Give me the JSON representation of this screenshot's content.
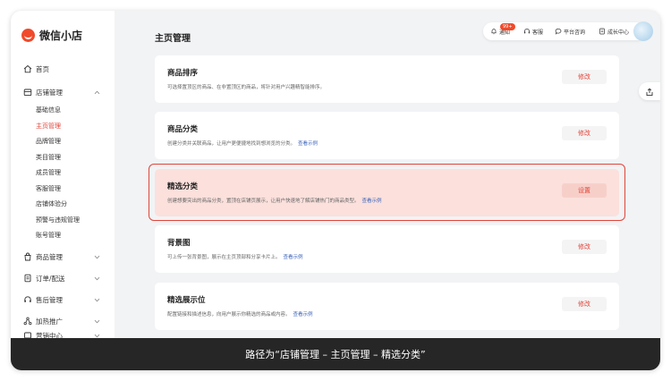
{
  "app": {
    "name": "微信小店"
  },
  "sidebar": {
    "items": [
      {
        "label": "首页",
        "icon": "home-icon"
      },
      {
        "label": "店铺管理",
        "icon": "store-icon",
        "expanded": true
      },
      {
        "label": "商品管理",
        "icon": "bag-icon"
      },
      {
        "label": "订单/配送",
        "icon": "order-icon"
      },
      {
        "label": "售后管理",
        "icon": "headset-icon"
      },
      {
        "label": "加热推广",
        "icon": "share-icon"
      },
      {
        "label": "营销中心",
        "icon": "marketing-icon"
      }
    ],
    "store_sub_items": [
      {
        "label": "基础信息"
      },
      {
        "label": "主页管理",
        "active": true
      },
      {
        "label": "品牌管理"
      },
      {
        "label": "类目管理"
      },
      {
        "label": "成员管理"
      },
      {
        "label": "客服管理"
      },
      {
        "label": "店铺体验分"
      },
      {
        "label": "预警与违规管理"
      },
      {
        "label": "账号管理"
      }
    ]
  },
  "header": {
    "page_title": "主页管理",
    "topbar": {
      "notice_label": "通知",
      "notice_badge": "99+",
      "service_label": "客服",
      "consult_label": "平台咨询",
      "growth_label": "成长中心"
    }
  },
  "cards": [
    {
      "title": "商品排序",
      "desc": "可选择置顶区的商品、在非置顶区的商品，将针对用户兴趣精智能排序。",
      "link": "",
      "button": "修改",
      "highlighted": false
    },
    {
      "title": "商品分类",
      "desc": "创建分类并关联商品，让用户更便捷地找到想浏览的分类。",
      "link": "查看示例",
      "button": "修改",
      "highlighted": false
    },
    {
      "title": "精选分类",
      "desc": "创建想要突出的商品分类，置顶在店铺页展示，让用户快速地了解店铺热门的商品类型。",
      "link": "查看示例",
      "button": "设置",
      "highlighted": true
    },
    {
      "title": "背景图",
      "desc": "可上传一张背景图，展示在主页顶部和分享卡片上。",
      "link": "查看示例",
      "button": "修改",
      "highlighted": false
    },
    {
      "title": "精选展示位",
      "desc": "配置链接和描述信息，向用户展示你精选的商品或内容。",
      "link": "查看示例",
      "button": "修改",
      "highlighted": false
    }
  ],
  "caption": {
    "text": "路径为“店铺管理 – 主页管理 – 精选分类”"
  },
  "colors": {
    "accent": "#e0453a",
    "link": "#3b62b8",
    "highlight_bg": "#fbe0dc",
    "caption_bg": "#262626"
  }
}
